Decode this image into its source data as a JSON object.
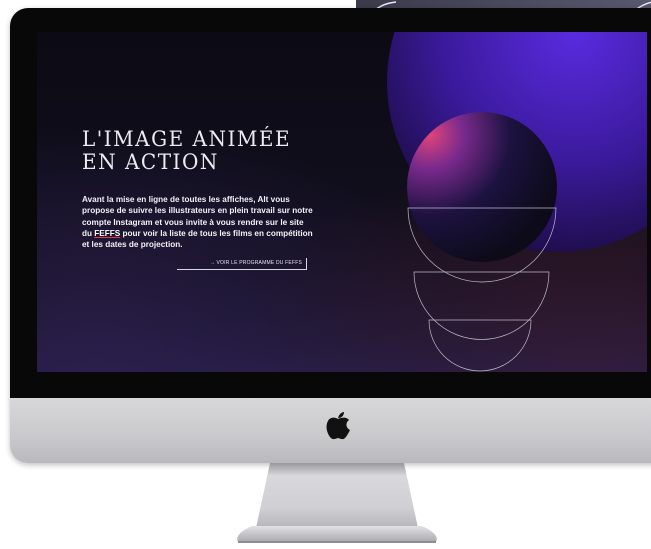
{
  "screen": {
    "headline_line1": "L'IMAGE ANIMÉE",
    "headline_line2": "EN ACTION",
    "body": {
      "part1": "Avant la mise en ligne de toutes les affiches, Alt vous propose de suivre les illustrateurs en plein travail  sur notre compte Instagram et vous invite à vous rendre sur le site du ",
      "link": "FEFFS",
      "part2": " pour voir la liste de tous les films en compétition et les dates de projection."
    },
    "cta_label": "→ VOIR LE PROGRAMME DU FEFFS"
  },
  "colors": {
    "screen_bg": "#0c0b14",
    "accent_purple": "#6a2fd4",
    "link_underline": "#e23a3a",
    "bezel": "#080808",
    "chin": "#cfcfd2"
  },
  "icons": {
    "logo": "apple-logo-icon"
  }
}
